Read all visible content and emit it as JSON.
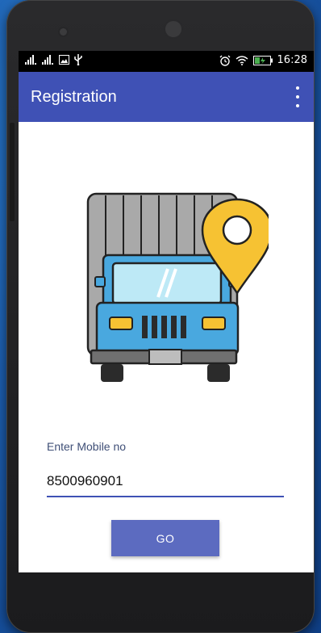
{
  "status_bar": {
    "time": "16:28",
    "icons": [
      "signal-bars-icon",
      "signal-bars-icon",
      "image-icon",
      "usb-icon",
      "alarm-icon",
      "wifi-icon",
      "battery-charging-icon"
    ]
  },
  "app_bar": {
    "title": "Registration",
    "overflow_icon": "more-vert-icon"
  },
  "illustration": {
    "subject": "truck-with-location-pin",
    "colors": {
      "truck_body": "#49a8df",
      "windshield": "#bde9f6",
      "cargo": "#a9a9a9",
      "pin": "#f6c233",
      "lights": "#f6c233",
      "outline": "#222222"
    }
  },
  "form": {
    "mobile_label": "Enter Mobile no",
    "mobile_value": "8500960901",
    "go_label": "GO"
  },
  "colors": {
    "primary": "#3f51b5",
    "button": "#5c6bc0",
    "status_bar": "#000000"
  }
}
